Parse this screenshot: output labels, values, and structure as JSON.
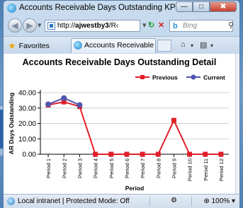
{
  "window": {
    "title": "Accounts Receivable Days Outstanding KPI Detail - Win...",
    "buttons": {
      "minimize": "—",
      "maximize": "□",
      "close": "✖"
    }
  },
  "nav": {
    "url_prefix": "http://",
    "url_host": "ajwestby3",
    "url_rest": "/R‹",
    "search_placeholder": "Bing"
  },
  "favorites": {
    "label": "Favorites",
    "tab_label": "Accounts Receivable Da..."
  },
  "report": {
    "title": "Accounts Receivable Days Outstanding Detail"
  },
  "chart_data": {
    "type": "line",
    "title": "",
    "xlabel": "Period",
    "ylabel": "AR Days Outstanding",
    "ylim": [
      0,
      40
    ],
    "yticks": [
      "0.00",
      "10.00",
      "20.00",
      "30.00",
      "40.00"
    ],
    "categories": [
      "Period 1",
      "Period 2",
      "Period 3",
      "Period 4",
      "Period 5",
      "Period 6",
      "Period 7",
      "Period 8",
      "Period 9",
      "Period 10",
      "Period 11",
      "Period 12"
    ],
    "legend_position": "top-right",
    "series": [
      {
        "name": "Previous",
        "color": "#e0202a",
        "marker": "square",
        "values": [
          32,
          34,
          31,
          0,
          0,
          0,
          0,
          0,
          22,
          0,
          0,
          0
        ]
      },
      {
        "name": "Current",
        "color": "#5254b0",
        "marker": "circle",
        "values": [
          32.5,
          36.5,
          32,
          null,
          null,
          null,
          null,
          null,
          null,
          null,
          null,
          null
        ]
      }
    ]
  },
  "status": {
    "text": "Local intranet | Protected Mode: Off",
    "zoom": "100%"
  }
}
